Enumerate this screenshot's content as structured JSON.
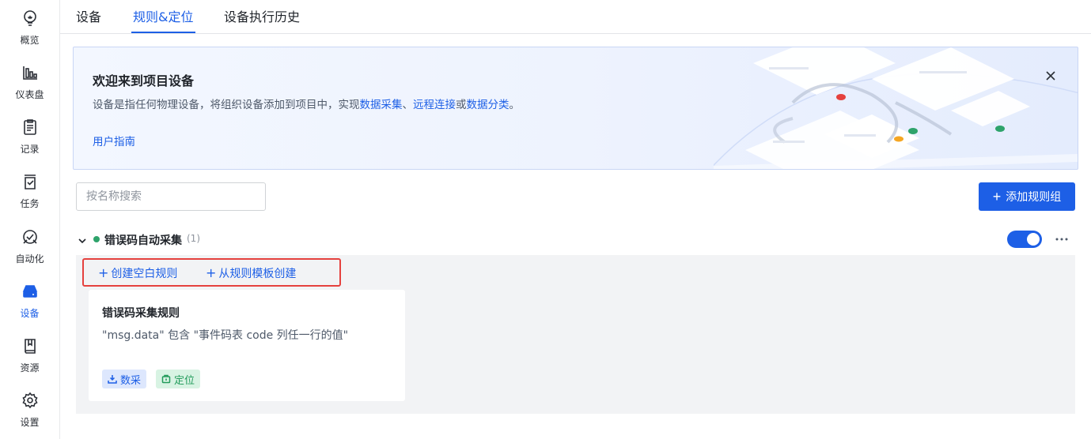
{
  "sidebar": {
    "items": [
      {
        "label": "概览",
        "icon": "bulb-icon",
        "active": false
      },
      {
        "label": "仪表盘",
        "icon": "bar-chart-icon",
        "active": false
      },
      {
        "label": "记录",
        "icon": "clipboard-icon",
        "active": false
      },
      {
        "label": "任务",
        "icon": "task-check-icon",
        "active": false
      },
      {
        "label": "自动化",
        "icon": "automation-icon",
        "active": false
      },
      {
        "label": "设备",
        "icon": "device-icon",
        "active": true
      },
      {
        "label": "资源",
        "icon": "book-icon",
        "active": false
      },
      {
        "label": "设置",
        "icon": "gear-icon",
        "active": false
      }
    ]
  },
  "tabs": [
    {
      "label": "设备",
      "active": false
    },
    {
      "label": "规则&定位",
      "active": true
    },
    {
      "label": "设备执行历史",
      "active": false
    }
  ],
  "banner": {
    "title": "欢迎来到项目设备",
    "desc_prefix": "设备是指任何物理设备，将组织设备添加到项目中，实现",
    "link_data_collect": "数据采集",
    "sep1": "、",
    "link_remote": "远程连接",
    "sep2": "或",
    "link_classify": "数据分类",
    "desc_suffix": "。",
    "guide": "用户指南"
  },
  "search": {
    "placeholder": "按名称搜索",
    "value": ""
  },
  "add_group_button": "添加规则组",
  "group": {
    "name": "错误码自动采集",
    "count": "(1)",
    "enabled": true,
    "status_color": "#2ea36b",
    "actions": {
      "create_blank": "创建空白规则",
      "create_from_template": "从规则模板创建"
    },
    "rule": {
      "title": "错误码采集规则",
      "desc": "\"msg.data\" 包含 \"事件码表 code 列任一行的值\"",
      "tags": [
        {
          "label": "数采",
          "icon": "download-tray-icon"
        },
        {
          "label": "定位",
          "icon": "locate-box-icon"
        }
      ]
    }
  },
  "colors": {
    "accent": "#1d5fe6",
    "highlight": "#e5413e",
    "success": "#2ea36b"
  }
}
